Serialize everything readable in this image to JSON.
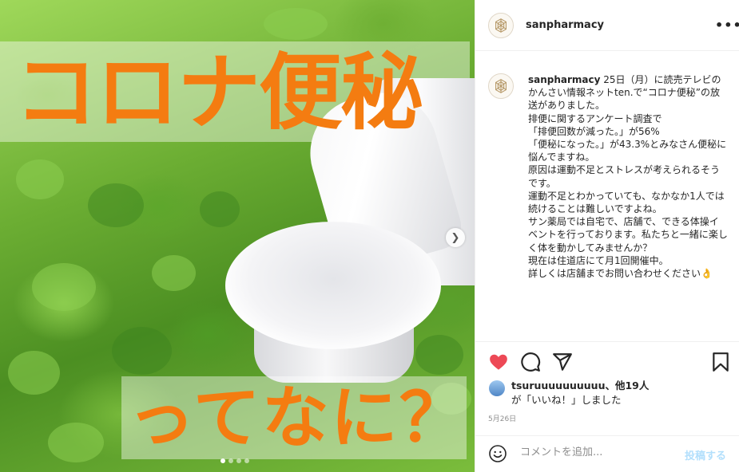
{
  "post_image": {
    "title_overlay": "コロナ便秘",
    "subtitle_overlay": "ってなに？",
    "carousel": {
      "current": 1,
      "total": 4
    },
    "next_icon": "chevron-right-icon",
    "colors": {
      "overlay_text": "#f47c11"
    }
  },
  "header": {
    "username": "sanpharmacy",
    "more_icon": "ellipsis-icon",
    "more_label": "•••"
  },
  "caption": {
    "username": "sanpharmacy",
    "text": " 25日（月）に読売テレビのかんさい情報ネットten.で“コロナ便秘”の放送がありました。\n排便に関するアンケート調査で\n「排便回数が減った。」が56%\n「便秘になった。」が43.3%とみなさん便秘に悩んでますね。\n原因は運動不足とストレスが考えられるそうです。\n運動不足とわかっていても、なかなか1人では続けることは難しいですよね。\nサン薬局では自宅で、店舗で、できる体操イベントを行っております。私たちと一緒に楽しく体を動かしてみませんか？\n現在は住道店にて月1回開催中。\n詳しくは店舗までお問い合わせください👌"
  },
  "actions": {
    "like_icon": "heart-icon",
    "comment_icon": "comment-icon",
    "share_icon": "send-icon",
    "save_icon": "bookmark-icon",
    "colors": {
      "liked": "#ed4956"
    }
  },
  "likes": {
    "user": "tsuruuuuuuuuuu",
    "others": "、他19人",
    "suffix": "が「いいね！」しました"
  },
  "date": "5月26日",
  "comment_box": {
    "emoji_icon": "smiley-icon",
    "placeholder": "コメントを追加...",
    "post_label": "投稿する",
    "colors": {
      "post_disabled": "#b2dffc"
    }
  }
}
